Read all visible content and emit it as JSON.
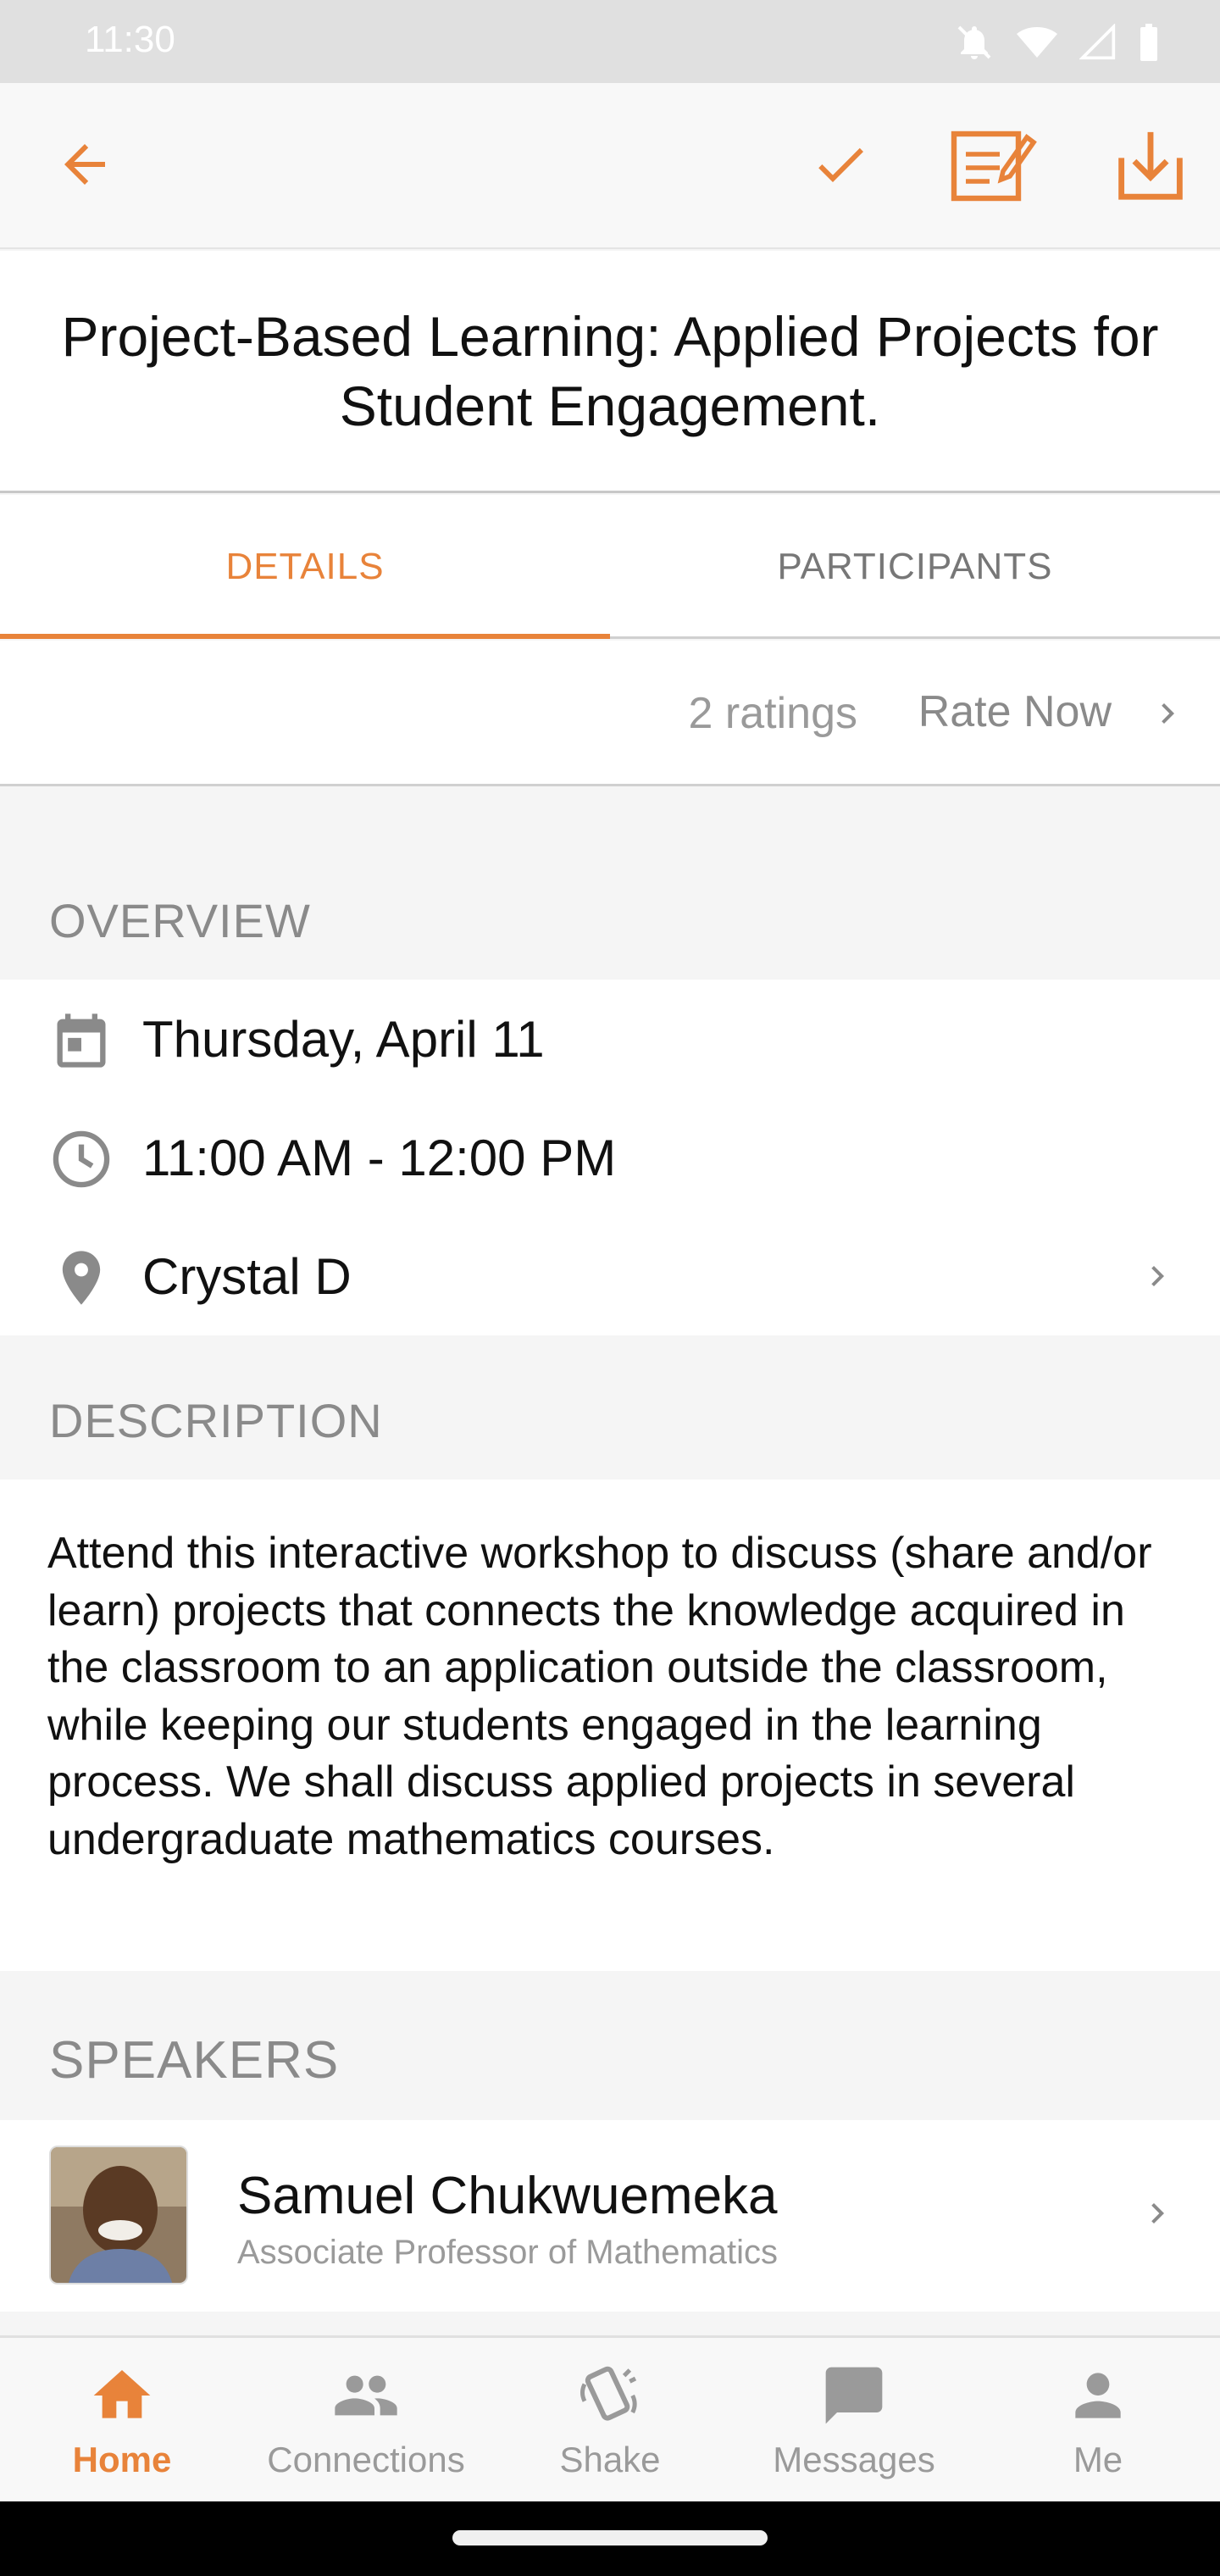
{
  "status_bar": {
    "time": "11:30",
    "icons": [
      "mute-icon",
      "wifi-icon",
      "signal-icon",
      "battery-icon"
    ]
  },
  "app_bar": {
    "icons": [
      "back-arrow-icon",
      "checkmark-icon",
      "note-icon",
      "download-icon"
    ],
    "accent": "#e8833a"
  },
  "session": {
    "title": "Project-Based Learning: Applied Projects for Student Engagement."
  },
  "tabs": [
    {
      "label": "DETAILS",
      "active": true
    },
    {
      "label": "PARTICIPANTS",
      "active": false
    }
  ],
  "ratings": {
    "count": "2 ratings",
    "rate_label": "Rate Now"
  },
  "overview": {
    "label": "OVERVIEW",
    "date": "Thursday, April 11",
    "time": "11:00 AM - 12:00 PM",
    "location": "Crystal D"
  },
  "description": {
    "label": "DESCRIPTION",
    "text": "Attend this interactive workshop to discuss (share and/or learn) projects that connects the knowledge acquired in the classroom to an application outside the classroom, while keeping our students engaged in the learning process. We shall discuss applied projects in several undergraduate mathematics courses."
  },
  "speakers": {
    "label": "SPEAKERS",
    "items": [
      {
        "name": "Samuel Chukwuemeka",
        "title": "Associate Professor of Mathematics"
      }
    ]
  },
  "bottom_nav": [
    {
      "label": "Home",
      "icon": "home-icon",
      "active": true
    },
    {
      "label": "Connections",
      "icon": "people-icon",
      "active": false
    },
    {
      "label": "Shake",
      "icon": "shake-phone-icon",
      "active": false
    },
    {
      "label": "Messages",
      "icon": "message-icon",
      "active": false
    },
    {
      "label": "Me",
      "icon": "person-icon",
      "active": false
    }
  ]
}
